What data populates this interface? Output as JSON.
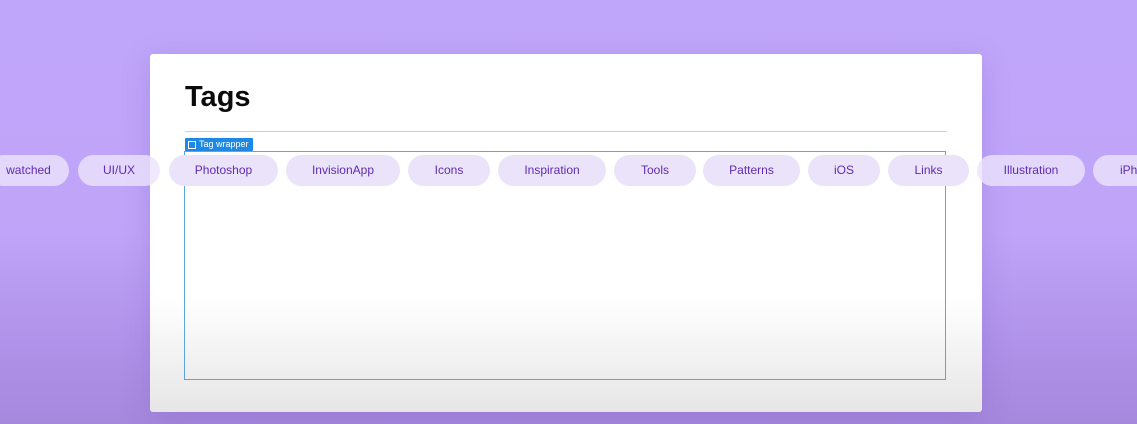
{
  "card": {
    "title": "Tags",
    "selection_label": "Tag wrapper"
  },
  "tags": [
    "watched",
    "UI/UX",
    "Photoshop",
    "InvisionApp",
    "Icons",
    "Inspiration",
    "Tools",
    "Patterns",
    "iOS",
    "Links",
    "Illustration",
    "iPh"
  ],
  "colors": {
    "background": "#c0a6fb",
    "tag_background": "#ebe3fa",
    "tag_text": "#5f2bb0",
    "selection_accent": "#1e88e5"
  }
}
